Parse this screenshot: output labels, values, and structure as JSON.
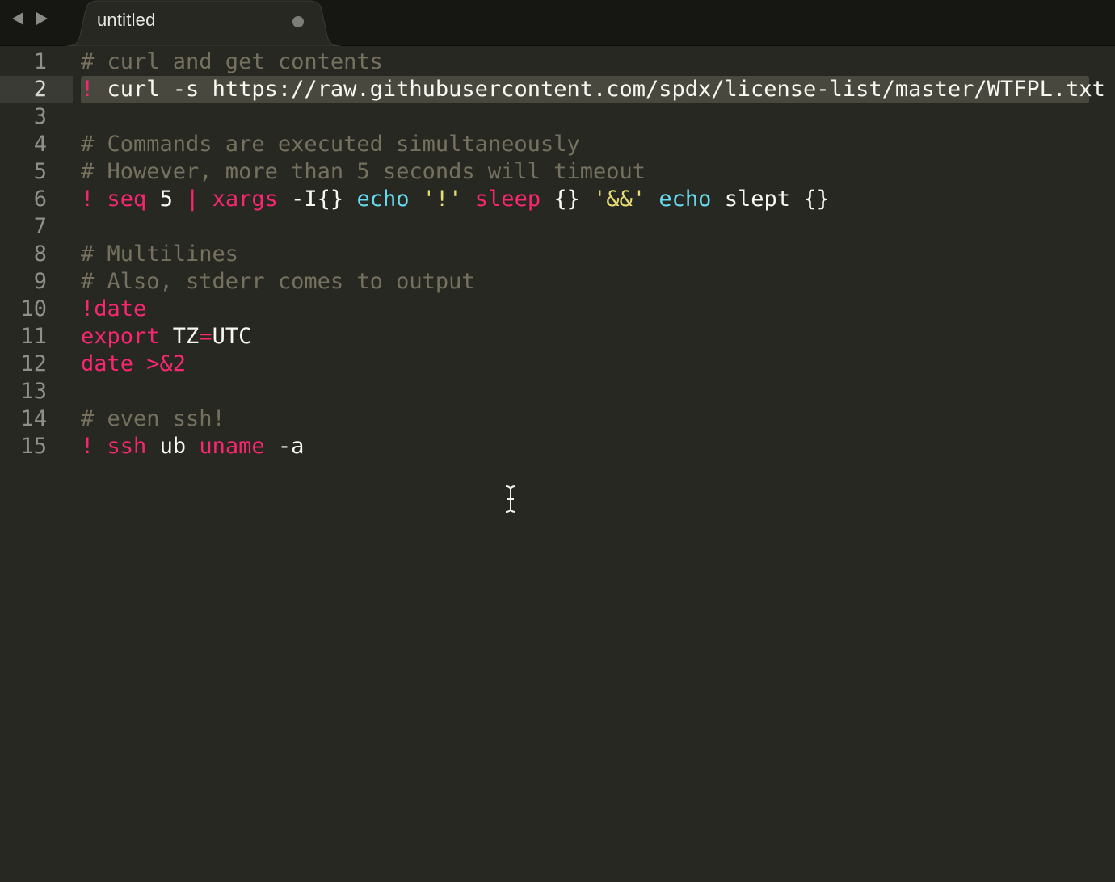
{
  "tab": {
    "title": "untitled"
  },
  "colors": {
    "background": "#272822",
    "comment": "#75715e",
    "keyword": "#f92672",
    "function": "#66d9ef",
    "string": "#e6db74",
    "text": "#f8f8f2",
    "selection": "#49483e"
  },
  "icons": {
    "back": "triangle-left-icon",
    "forward": "triangle-right-icon",
    "dirty": "unsaved-dot-icon",
    "cursor": "ibeam-cursor-icon"
  },
  "editor": {
    "active_line": 2,
    "line_numbers": [
      "1",
      "2",
      "3",
      "4",
      "5",
      "6",
      "7",
      "8",
      "9",
      "10",
      "11",
      "12",
      "13",
      "14",
      "15"
    ],
    "lines": [
      [
        {
          "t": "# curl and get contents",
          "c": "comment"
        }
      ],
      [
        {
          "t": "!",
          "c": "kw"
        },
        {
          "t": " curl -s https://raw.githubusercontent.com/spdx/license-list/master/WTFPL.txt",
          "c": "plain"
        }
      ],
      [],
      [
        {
          "t": "# Commands are executed simultaneously",
          "c": "comment"
        }
      ],
      [
        {
          "t": "# However, more than 5 seconds will timeout",
          "c": "comment"
        }
      ],
      [
        {
          "t": "!",
          "c": "kw"
        },
        {
          "t": " ",
          "c": "plain"
        },
        {
          "t": "seq",
          "c": "kw"
        },
        {
          "t": " 5 ",
          "c": "plain"
        },
        {
          "t": "|",
          "c": "kw"
        },
        {
          "t": " ",
          "c": "plain"
        },
        {
          "t": "xargs",
          "c": "kw"
        },
        {
          "t": " -I{} ",
          "c": "plain"
        },
        {
          "t": "echo",
          "c": "fn"
        },
        {
          "t": " ",
          "c": "plain"
        },
        {
          "t": "'!'",
          "c": "str"
        },
        {
          "t": " ",
          "c": "plain"
        },
        {
          "t": "sleep",
          "c": "kw"
        },
        {
          "t": " {} ",
          "c": "plain"
        },
        {
          "t": "'&&'",
          "c": "str"
        },
        {
          "t": " ",
          "c": "plain"
        },
        {
          "t": "echo",
          "c": "fn"
        },
        {
          "t": " slept {}",
          "c": "plain"
        }
      ],
      [],
      [
        {
          "t": "# Multilines",
          "c": "comment"
        }
      ],
      [
        {
          "t": "# Also, stderr comes to output",
          "c": "comment"
        }
      ],
      [
        {
          "t": "!date",
          "c": "kw"
        }
      ],
      [
        {
          "t": "export",
          "c": "kw"
        },
        {
          "t": " TZ",
          "c": "plain"
        },
        {
          "t": "=",
          "c": "kw"
        },
        {
          "t": "UTC",
          "c": "plain"
        }
      ],
      [
        {
          "t": "date >&2",
          "c": "kw"
        }
      ],
      [],
      [
        {
          "t": "# even ssh!",
          "c": "comment"
        }
      ],
      [
        {
          "t": "!",
          "c": "kw"
        },
        {
          "t": " ",
          "c": "plain"
        },
        {
          "t": "ssh",
          "c": "kw"
        },
        {
          "t": " ub ",
          "c": "plain"
        },
        {
          "t": "uname",
          "c": "kw"
        },
        {
          "t": " -a",
          "c": "plain"
        }
      ]
    ]
  }
}
